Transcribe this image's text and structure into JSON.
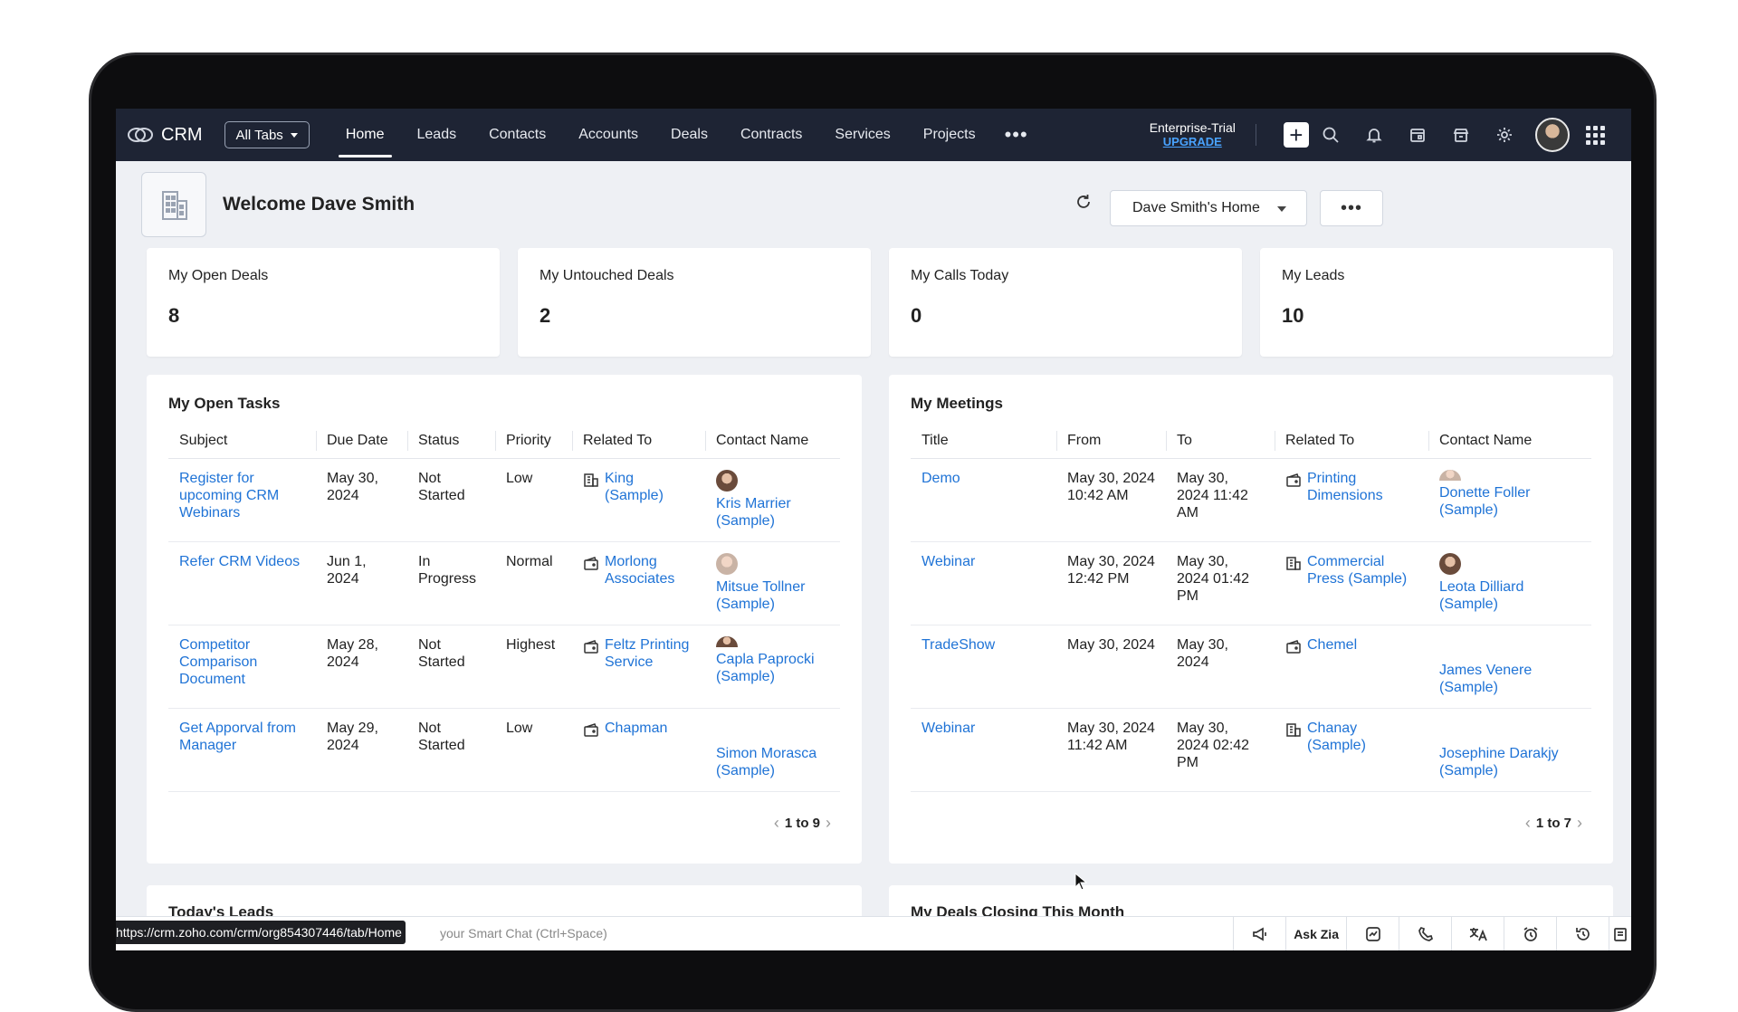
{
  "nav": {
    "brand": "CRM",
    "all_tabs": "All Tabs",
    "tabs": [
      {
        "label": "Home",
        "active": true
      },
      {
        "label": "Leads"
      },
      {
        "label": "Contacts"
      },
      {
        "label": "Accounts"
      },
      {
        "label": "Deals"
      },
      {
        "label": "Contracts"
      },
      {
        "label": "Services"
      },
      {
        "label": "Projects"
      }
    ],
    "more": "•••",
    "trial_label": "Enterprise-Trial",
    "upgrade_label": "UPGRADE",
    "icons": [
      "plus-icon",
      "search-icon",
      "bell-icon",
      "calendar-icon",
      "store-icon",
      "gear-icon",
      "avatar",
      "apps-grid-icon"
    ]
  },
  "home": {
    "welcome": "Welcome Dave Smith",
    "view_selector": "Dave Smith's Home",
    "more": "•••"
  },
  "kpis": [
    {
      "label": "My Open Deals",
      "value": "8"
    },
    {
      "label": "My Untouched Deals",
      "value": "2"
    },
    {
      "label": "My Calls Today",
      "value": "0"
    },
    {
      "label": "My Leads",
      "value": "10"
    }
  ],
  "tasks": {
    "title": "My Open Tasks",
    "columns": [
      "Subject",
      "Due Date",
      "Status",
      "Priority",
      "Related To",
      "Contact Name"
    ],
    "rows": [
      {
        "subject": "Register for upcoming CRM Webinars",
        "due": "May 30, 2024",
        "status": "Not Started",
        "priority": "Low",
        "related": "King (Sample)",
        "related_icon": "building-icon",
        "contact": "Kris Marrier (Sample)",
        "avatar": "photo"
      },
      {
        "subject": "Refer CRM Videos",
        "due": "Jun 1, 2024",
        "status": "In Progress",
        "priority": "Normal",
        "related": "Morlong Associates",
        "related_icon": "deal-icon",
        "contact": "Mitsue Tollner (Sample)",
        "avatar": "light"
      },
      {
        "subject": "Competitor Comparison Document",
        "due": "May 28, 2024",
        "status": "Not Started",
        "priority": "Highest",
        "related": "Feltz Printing Service",
        "related_icon": "deal-icon",
        "contact": "Capla Paprocki (Sample)",
        "avatar": "half"
      },
      {
        "subject": "Get Apporval from Manager",
        "due": "May 29, 2024",
        "status": "Not Started",
        "priority": "Low",
        "related": "Chapman",
        "related_icon": "deal-icon",
        "contact": "Simon Morasca (Sample)",
        "avatar": "none"
      }
    ],
    "pager": {
      "range": "1 to 9"
    }
  },
  "meetings": {
    "title": "My Meetings",
    "columns": [
      "Title",
      "From",
      "To",
      "Related To",
      "Contact Name"
    ],
    "rows": [
      {
        "title": "Demo",
        "from": "May 30, 2024 10:42 AM",
        "to": "May 30, 2024 11:42 AM",
        "related": "Printing Dimensions",
        "related_icon": "deal-icon",
        "contact": "Donette Foller (Sample)",
        "avatar": "half"
      },
      {
        "title": "Webinar",
        "from": "May 30, 2024 12:42 PM",
        "to": "May 30, 2024 01:42 PM",
        "related": "Commercial Press (Sample)",
        "related_icon": "building-icon",
        "contact": "Leota Dilliard (Sample)",
        "avatar": "photo"
      },
      {
        "title": "TradeShow",
        "from": "May 30, 2024",
        "to": "May 30, 2024",
        "related": "Chemel",
        "related_icon": "deal-icon",
        "contact": "James Venere (Sample)",
        "avatar": "none"
      },
      {
        "title": "Webinar",
        "from": "May 30, 2024 11:42 AM",
        "to": "May 30, 2024 02:42 PM",
        "related": "Chanay (Sample)",
        "related_icon": "building-icon",
        "contact": "Josephine Darakjy (Sample)",
        "avatar": "none"
      }
    ],
    "pager": {
      "range": "1 to 7"
    }
  },
  "lower": {
    "leads_title": "Today's Leads",
    "deals_title": "My Deals Closing This Month"
  },
  "bottom": {
    "url": "https://crm.zoho.com/crm/org854307446/tab/Home",
    "smart_chat": "your Smart Chat (Ctrl+Space)",
    "ask_zia": "Ask Zia"
  }
}
